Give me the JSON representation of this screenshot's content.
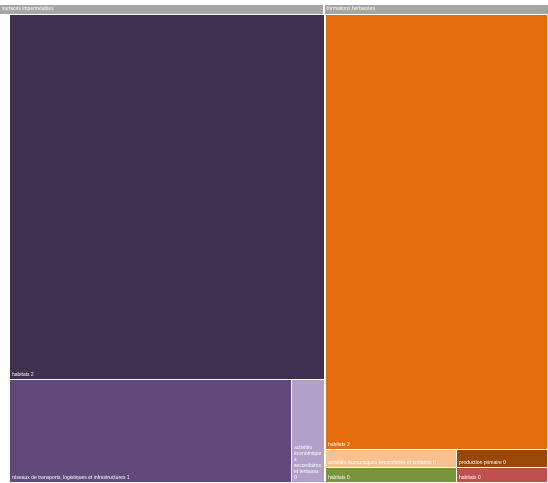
{
  "chart_data": {
    "type": "treemap",
    "groups": [
      {
        "name": "surfaces imperméables",
        "children": [
          {
            "label": "habitats 2",
            "name": "habitats",
            "value": 2,
            "color": "#40304f"
          },
          {
            "label": "réseaux de transports, logistiques et infrastructures 1",
            "name": "réseaux de transports, logistiques et infrastructures",
            "value": 1,
            "color": "#604a7b"
          },
          {
            "label": "activités économiques secondaires et tertiaires 0",
            "name": "activités économiques secondaires et tertiaires",
            "value": 0,
            "color": "#b1a0c7"
          }
        ]
      },
      {
        "name": "formations herbacées",
        "children": [
          {
            "label": "habitats 2",
            "name": "habitats",
            "value": 2,
            "color": "#e46c0a"
          },
          {
            "label": "activités économiques secondaires et tertiaires 0",
            "name": "activités économiques secondaires et tertiaires",
            "value": 0,
            "color": "#fac090"
          },
          {
            "label": "production primaire 0",
            "name": "production primaire",
            "value": 0,
            "color": "#984807"
          },
          {
            "label": "habitats 0",
            "name": "habitats",
            "value": 0,
            "color": "#77933c"
          },
          {
            "label": "habitats 0",
            "name": "habitats",
            "value": 0,
            "color": "#c0504d"
          }
        ]
      }
    ]
  }
}
